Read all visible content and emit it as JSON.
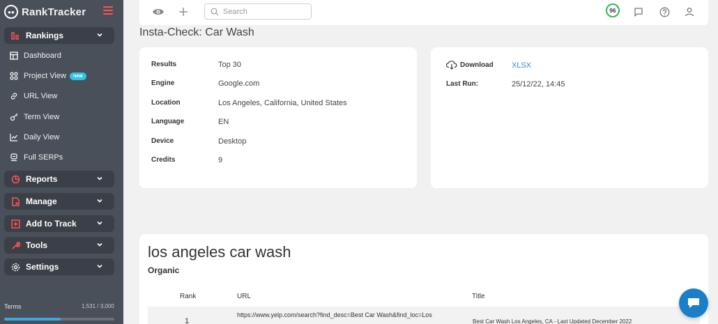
{
  "brand": {
    "name": "RankTracker"
  },
  "sidebar": {
    "sections": {
      "rankings": "Rankings",
      "reports": "Reports",
      "manage": "Manage",
      "add_to_track": "Add to Track",
      "tools": "Tools",
      "settings": "Settings"
    },
    "items": [
      {
        "label": "Dashboard",
        "icon": "dashboard-icon"
      },
      {
        "label": "Project View",
        "icon": "project-icon",
        "badge": "new"
      },
      {
        "label": "URL View",
        "icon": "link-icon"
      },
      {
        "label": "Term View",
        "icon": "key-icon"
      },
      {
        "label": "Daily View",
        "icon": "line-chart-icon"
      },
      {
        "label": "Full SERPs",
        "icon": "serp-icon"
      }
    ],
    "footer": {
      "terms": "Terms",
      "credits": "1,531 / 3,000",
      "credits_fraction": 0.51
    }
  },
  "topbar": {
    "search_placeholder": "Search",
    "score": "96",
    "score_color": "#2eb85c"
  },
  "page": {
    "title": "Insta-Check: Car Wash"
  },
  "details": {
    "results_label": "Results",
    "results": "Top 30",
    "engine_label": "Engine",
    "engine": "Google.com",
    "location_label": "Location",
    "location": "Los Angeles, California, United States",
    "language_label": "Language",
    "language": "EN",
    "device_label": "Device",
    "device": "Desktop",
    "credits_label": "Credits",
    "credits": "9"
  },
  "download": {
    "label": "Download",
    "format": "XLSX",
    "last_run_label": "Last Run:",
    "last_run": "25/12/22, 14:45"
  },
  "results": {
    "keyword": "los angeles car wash",
    "type": "Organic",
    "columns": {
      "rank": "Rank",
      "url": "URL",
      "title": "Title"
    },
    "rows": [
      {
        "rank": "1",
        "url": "https://www.yelp.com/search?find_desc=Best Car Wash&find_loc=Los",
        "title": "Best Car Wash Los Angeles, CA - Last Updated December 2022"
      }
    ]
  },
  "colors": {
    "sidebar": "#4a5059",
    "accent": "#2b8fd6",
    "chat": "#1a7fc8",
    "menu": "#ff5252"
  }
}
